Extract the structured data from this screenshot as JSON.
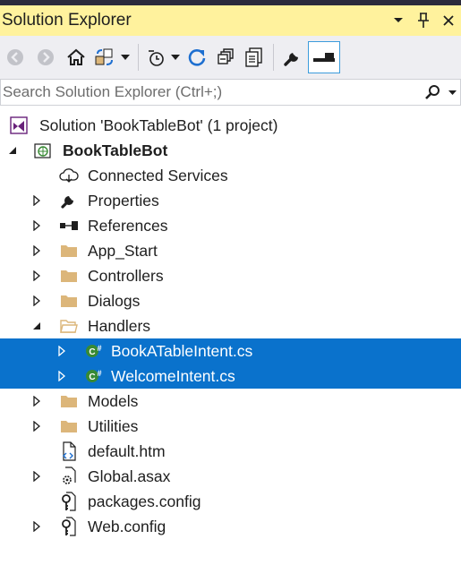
{
  "window": {
    "title": "Solution Explorer",
    "buttons": [
      "dropdown-arrow",
      "pin",
      "close"
    ]
  },
  "toolbar": {
    "items": [
      "back-icon",
      "forward-icon",
      "home-icon",
      "sync-with-active-document-icon",
      "dropdown-arrow",
      "pending-changes-filter-icon",
      "dropdown-arrow",
      "refresh-icon",
      "collapse-all-icon",
      "show-all-files-icon",
      "properties-wrench-icon",
      "preview-selected-items-icon"
    ]
  },
  "search": {
    "placeholder": "Search Solution Explorer (Ctrl+;)",
    "value": ""
  },
  "tree": {
    "solution": "Solution 'BookTableBot' (1 project)",
    "project": "BookTableBot",
    "connected_services": "Connected Services",
    "properties": "Properties",
    "references": "References",
    "app_start": "App_Start",
    "controllers": "Controllers",
    "dialogs": "Dialogs",
    "handlers": "Handlers",
    "handler_file_1": "BookATableIntent.cs",
    "handler_file_2": "WelcomeIntent.cs",
    "models": "Models",
    "utilities": "Utilities",
    "default_htm": "default.htm",
    "global_asax": "Global.asax",
    "packages_config": "packages.config",
    "web_config": "Web.config"
  },
  "colors": {
    "title_bar": "#fff29d",
    "toolbar": "#eeeef2",
    "selection": "#0a72cc",
    "folder": "#dcb67a",
    "solution_icon": "#68217a",
    "csharp": "#388a34"
  }
}
